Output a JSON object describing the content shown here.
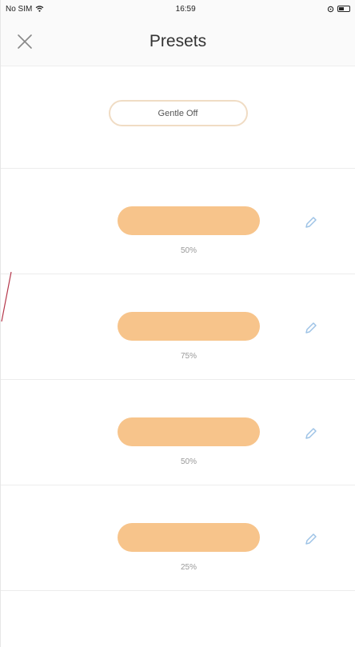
{
  "status_bar": {
    "carrier": "No SIM",
    "time": "16:59"
  },
  "header": {
    "title": "Presets",
    "close_icon": "close-icon"
  },
  "gentle_off": {
    "label": "Gentle Off"
  },
  "presets": [
    {
      "label": "50%",
      "icon": "pencil-icon"
    },
    {
      "label": "75%",
      "icon": "pencil-icon"
    },
    {
      "label": "50%",
      "icon": "pencil-icon"
    },
    {
      "label": "25%",
      "icon": "pencil-icon"
    }
  ],
  "colors": {
    "accent": "#f7c48b",
    "outline": "#f0dcc4",
    "edit_icon": "#9ec3e6",
    "accent_line": "#b5384b"
  }
}
